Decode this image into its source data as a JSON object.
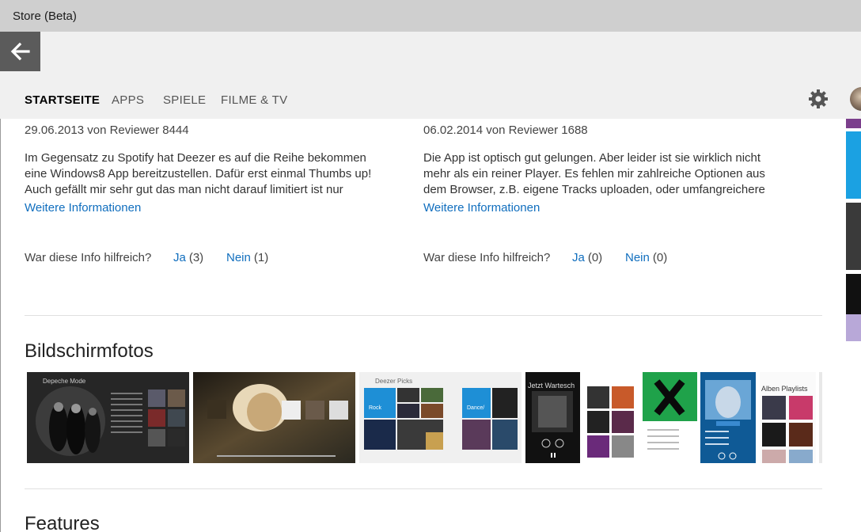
{
  "window": {
    "title": "Store (Beta)"
  },
  "nav": {
    "tabs": [
      {
        "label": "STARTSEITE",
        "active": true
      },
      {
        "label": "APPS",
        "active": false
      },
      {
        "label": "SPIELE",
        "active": false
      },
      {
        "label": "FILME & TV",
        "active": false
      }
    ],
    "settings_icon": "gear-icon",
    "back_icon": "arrow-left-icon"
  },
  "reviews": [
    {
      "meta": "29.06.2013 von Reviewer 8444",
      "body": "Im Gegensatz zu Spotify hat Deezer es auf die Reihe bekommen eine Windows8 App bereitzustellen. Dafür erst einmal Thumbs up! Auch gefällt mir sehr gut das man nicht darauf limitiert ist nur",
      "more": "Weitere Informationen",
      "helpful_q": "War diese Info hilfreich?",
      "yes_label": "Ja",
      "yes_count": "(3)",
      "no_label": "Nein",
      "no_count": "(1)"
    },
    {
      "meta": "06.02.2014 von Reviewer 1688",
      "body": "Die App ist optisch gut gelungen. Aber leider ist sie wirklich nicht mehr als ein reiner Player. Es fehlen mir zahlreiche Optionen aus dem Browser, z.B. eigene Tracks uploaden, oder umfangreichere",
      "more": "Weitere Informationen",
      "helpful_q": "War diese Info hilfreich?",
      "yes_label": "Ja",
      "yes_count": "(0)",
      "no_label": "Nein",
      "no_count": "(0)"
    }
  ],
  "screenshots": {
    "title": "Bildschirmfotos",
    "shots": [
      {
        "caption": "Depeche Mode",
        "bg": "#1e1e1e"
      },
      {
        "caption": "",
        "bg": "#2a2620"
      },
      {
        "caption": "Deezer Picks",
        "bg": "#f3f3f3"
      },
      {
        "caption": "Jetzt Wartesch",
        "bg": "#111111"
      },
      {
        "caption": "",
        "bg": "#ffffff"
      },
      {
        "caption": "",
        "bg": "#1fa24a"
      },
      {
        "caption": "",
        "bg": "#1677b8"
      },
      {
        "caption": "Alben Playlists",
        "bg": "#fafafa"
      }
    ]
  },
  "features": {
    "title": "Features"
  },
  "colors": {
    "link": "#106ebe",
    "titlebar": "#cfcfcf",
    "navbar": "#f0f0f0"
  }
}
